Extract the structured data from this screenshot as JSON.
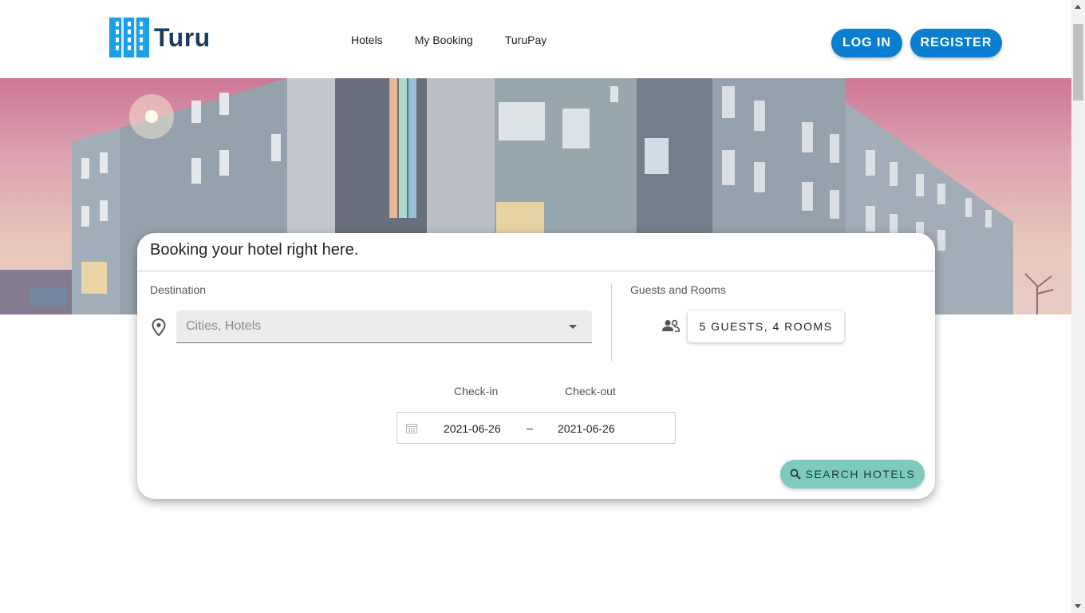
{
  "header": {
    "logo_text": "Turu",
    "nav": [
      "Hotels",
      "My Booking",
      "TuruPay"
    ],
    "login_label": "LOG IN",
    "register_label": "REGISTER"
  },
  "booking": {
    "title": "Booking your hotel right here.",
    "destination_label": "Destination",
    "destination_placeholder": "Cities, Hotels",
    "guests_label": "Guests and Rooms",
    "guests_value": "5 GUESTS, 4 ROOMS",
    "checkin_label": "Check-in",
    "checkout_label": "Check-out",
    "checkin_date": "2021-06-26",
    "date_separator": "–",
    "checkout_date": "2021-06-26",
    "search_label": "SEARCH HOTELS"
  },
  "colors": {
    "primary": "#0a7fd0",
    "accent": "#7fcabf",
    "logo": "#1aa0e6"
  },
  "icons": {
    "location": "location-pin-icon",
    "people": "people-icon",
    "calendar": "calendar-icon",
    "search": "search-icon",
    "dropdown": "chevron-down-icon"
  }
}
